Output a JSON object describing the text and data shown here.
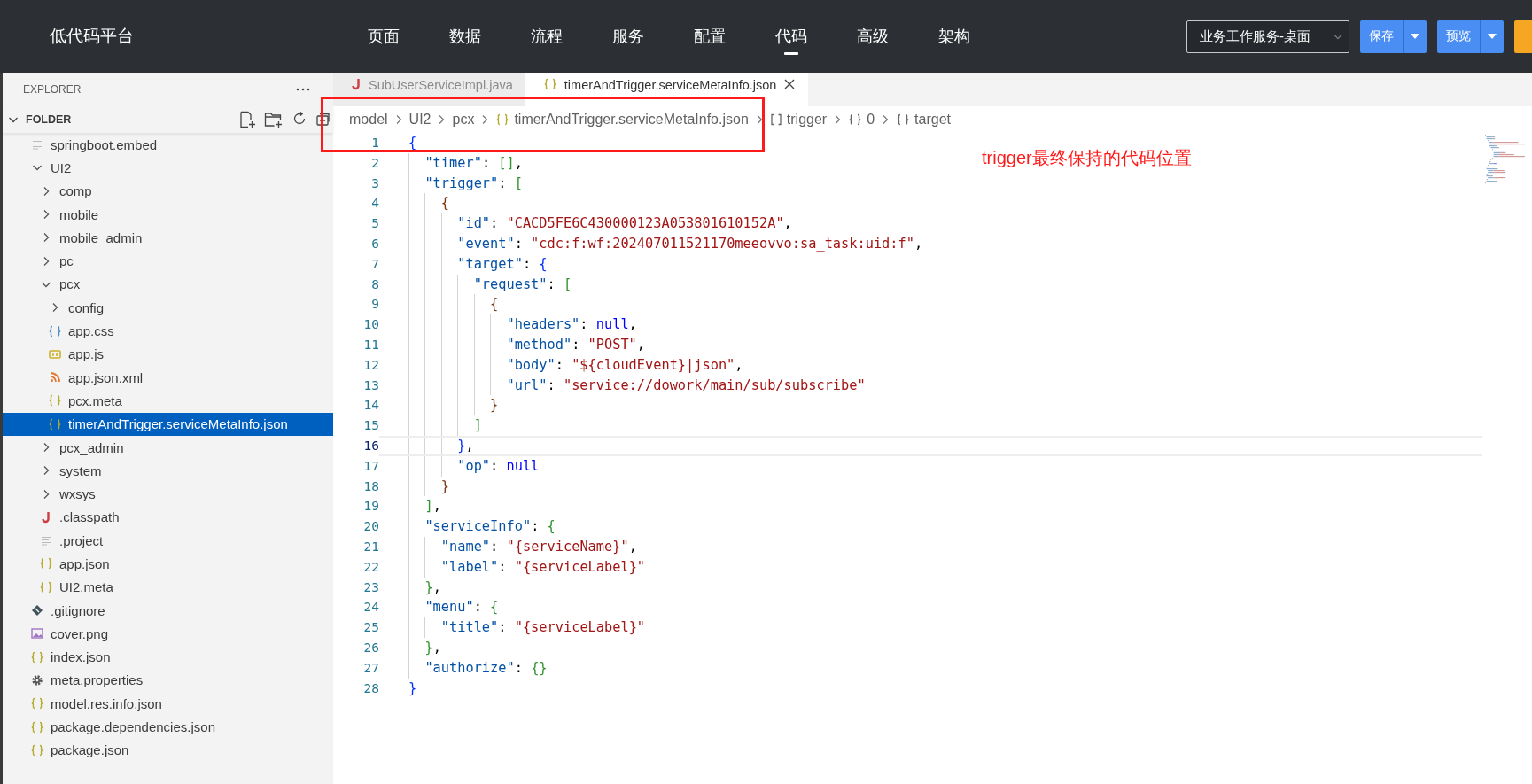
{
  "header": {
    "logo": "低代码平台",
    "nav": [
      {
        "label": "页面",
        "selected": false
      },
      {
        "label": "数据",
        "selected": false
      },
      {
        "label": "流程",
        "selected": false
      },
      {
        "label": "服务",
        "selected": false
      },
      {
        "label": "配置",
        "selected": false
      },
      {
        "label": "代码",
        "selected": true
      },
      {
        "label": "高级",
        "selected": false
      },
      {
        "label": "架构",
        "selected": false
      }
    ],
    "workspace_select": {
      "value": "业务工作服务-桌面"
    },
    "buttons": [
      {
        "kind": "split",
        "label": "保存"
      },
      {
        "kind": "split",
        "label": "预览"
      },
      {
        "kind": "partial"
      }
    ]
  },
  "explorer": {
    "title": "EXPLORER",
    "folder": {
      "label": "FOLDER",
      "expanded": true
    },
    "tree": [
      {
        "label": "springboot.embed",
        "kind": "text",
        "selected": false
      },
      {
        "label": "UI2",
        "kind": "folder",
        "expanded": true,
        "selected": false,
        "children": [
          {
            "label": "comp",
            "kind": "folder",
            "expanded": false,
            "selected": false
          },
          {
            "label": "mobile",
            "kind": "folder",
            "expanded": false,
            "selected": false
          },
          {
            "label": "mobile_admin",
            "kind": "folder",
            "expanded": false,
            "selected": false
          },
          {
            "label": "pc",
            "kind": "folder",
            "expanded": false,
            "selected": false
          },
          {
            "label": "pcx",
            "kind": "folder",
            "expanded": true,
            "selected": false,
            "children": [
              {
                "label": "config",
                "kind": "folder",
                "expanded": false,
                "selected": false
              },
              {
                "label": "app.css",
                "kind": "css",
                "selected": false
              },
              {
                "label": "app.js",
                "kind": "js",
                "selected": false
              },
              {
                "label": "app.json.xml",
                "kind": "feed",
                "selected": false
              },
              {
                "label": "pcx.meta",
                "kind": "json",
                "selected": false
              },
              {
                "label": "timerAndTrigger.serviceMetaInfo.json",
                "kind": "json",
                "selected": true
              }
            ]
          },
          {
            "label": "pcx_admin",
            "kind": "folder",
            "expanded": false,
            "selected": false
          },
          {
            "label": "system",
            "kind": "folder",
            "expanded": false,
            "selected": false
          },
          {
            "label": "wxsys",
            "kind": "folder",
            "expanded": false,
            "selected": false
          },
          {
            "label": ".classpath",
            "kind": "java",
            "selected": false
          },
          {
            "label": ".project",
            "kind": "text",
            "selected": false
          },
          {
            "label": "app.json",
            "kind": "json",
            "selected": false
          },
          {
            "label": "UI2.meta",
            "kind": "json",
            "selected": false
          }
        ]
      },
      {
        "label": ".gitignore",
        "kind": "git",
        "selected": false
      },
      {
        "label": "cover.png",
        "kind": "image",
        "selected": false
      },
      {
        "label": "index.json",
        "kind": "json",
        "selected": false
      },
      {
        "label": "meta.properties",
        "kind": "gear",
        "selected": false
      },
      {
        "label": "model.res.info.json",
        "kind": "json",
        "selected": false
      },
      {
        "label": "package.dependencies.json",
        "kind": "json",
        "selected": false
      },
      {
        "label": "package.json",
        "kind": "json",
        "selected": false
      }
    ]
  },
  "editor": {
    "tabs": [
      {
        "label": "SubUserServiceImpl.java",
        "kind": "java",
        "selected": false
      },
      {
        "label": "timerAndTrigger.serviceMetaInfo.json",
        "kind": "json",
        "selected": true
      }
    ],
    "breadcrumb": [
      {
        "label": "model"
      },
      {
        "label": "UI2"
      },
      {
        "label": "pcx"
      },
      {
        "label": "timerAndTrigger.serviceMetaInfo.json",
        "kind": "json"
      },
      {
        "label": "trigger",
        "kind": "array"
      },
      {
        "label": "0",
        "kind": "object"
      },
      {
        "label": "target",
        "kind": "object"
      }
    ],
    "lines": [
      {
        "number": "1",
        "current": false,
        "tokens": [
          {
            "kind": "ba",
            "text": "{"
          }
        ]
      },
      {
        "number": "2",
        "current": false,
        "tokens": [
          {
            "kind": "key",
            "text": "  \"timer\""
          },
          {
            "kind": "punct",
            "text": ": "
          },
          {
            "kind": "bb",
            "text": "[]"
          },
          {
            "kind": "punct",
            "text": ","
          }
        ]
      },
      {
        "number": "3",
        "current": false,
        "tokens": [
          {
            "kind": "key",
            "text": "  \"trigger\""
          },
          {
            "kind": "punct",
            "text": ": "
          },
          {
            "kind": "bb",
            "text": "["
          }
        ]
      },
      {
        "number": "4",
        "current": false,
        "tokens": [
          {
            "kind": "bc",
            "text": "    {"
          }
        ]
      },
      {
        "number": "5",
        "current": false,
        "tokens": [
          {
            "kind": "key",
            "text": "      \"id\""
          },
          {
            "kind": "punct",
            "text": ": "
          },
          {
            "kind": "str",
            "text": "\"CACD5FE6C430000123A053801610152A\""
          },
          {
            "kind": "punct",
            "text": ","
          }
        ]
      },
      {
        "number": "6",
        "current": false,
        "tokens": [
          {
            "kind": "key",
            "text": "      \"event\""
          },
          {
            "kind": "punct",
            "text": ": "
          },
          {
            "kind": "str",
            "text": "\"cdc:f:wf:202407011521170meeovvo:sa_task:uid:f\""
          },
          {
            "kind": "punct",
            "text": ","
          }
        ]
      },
      {
        "number": "7",
        "current": false,
        "tokens": [
          {
            "kind": "key",
            "text": "      \"target\""
          },
          {
            "kind": "punct",
            "text": ": "
          },
          {
            "kind": "ba",
            "text": "{"
          }
        ]
      },
      {
        "number": "8",
        "current": false,
        "tokens": [
          {
            "kind": "key",
            "text": "        \"request\""
          },
          {
            "kind": "punct",
            "text": ": "
          },
          {
            "kind": "bb",
            "text": "["
          }
        ]
      },
      {
        "number": "9",
        "current": false,
        "tokens": [
          {
            "kind": "bc",
            "text": "          {"
          }
        ]
      },
      {
        "number": "10",
        "current": false,
        "tokens": [
          {
            "kind": "key",
            "text": "            \"headers\""
          },
          {
            "kind": "punct",
            "text": ": "
          },
          {
            "kind": "null",
            "text": "null"
          },
          {
            "kind": "punct",
            "text": ","
          }
        ]
      },
      {
        "number": "11",
        "current": false,
        "tokens": [
          {
            "kind": "key",
            "text": "            \"method\""
          },
          {
            "kind": "punct",
            "text": ": "
          },
          {
            "kind": "str",
            "text": "\"POST\""
          },
          {
            "kind": "punct",
            "text": ","
          }
        ]
      },
      {
        "number": "12",
        "current": false,
        "tokens": [
          {
            "kind": "key",
            "text": "            \"body\""
          },
          {
            "kind": "punct",
            "text": ": "
          },
          {
            "kind": "str",
            "text": "\"${cloudEvent}|json\""
          },
          {
            "kind": "punct",
            "text": ","
          }
        ]
      },
      {
        "number": "13",
        "current": false,
        "tokens": [
          {
            "kind": "key",
            "text": "            \"url\""
          },
          {
            "kind": "punct",
            "text": ": "
          },
          {
            "kind": "str",
            "text": "\"service://dowork/main/sub/subscribe\""
          }
        ]
      },
      {
        "number": "14",
        "current": false,
        "tokens": [
          {
            "kind": "bc",
            "text": "          }"
          }
        ]
      },
      {
        "number": "15",
        "current": false,
        "tokens": [
          {
            "kind": "bb",
            "text": "        ]"
          }
        ]
      },
      {
        "number": "16",
        "current": true,
        "tokens": [
          {
            "kind": "ba",
            "text": "      }"
          },
          {
            "kind": "punct",
            "text": ","
          }
        ]
      },
      {
        "number": "17",
        "current": false,
        "tokens": [
          {
            "kind": "key",
            "text": "      \"op\""
          },
          {
            "kind": "punct",
            "text": ": "
          },
          {
            "kind": "null",
            "text": "null"
          }
        ]
      },
      {
        "number": "18",
        "current": false,
        "tokens": [
          {
            "kind": "bc",
            "text": "    }"
          }
        ]
      },
      {
        "number": "19",
        "current": false,
        "tokens": [
          {
            "kind": "bb",
            "text": "  ]"
          },
          {
            "kind": "punct",
            "text": ","
          }
        ]
      },
      {
        "number": "20",
        "current": false,
        "tokens": [
          {
            "kind": "key",
            "text": "  \"serviceInfo\""
          },
          {
            "kind": "punct",
            "text": ": "
          },
          {
            "kind": "bb",
            "text": "{"
          }
        ]
      },
      {
        "number": "21",
        "current": false,
        "tokens": [
          {
            "kind": "key",
            "text": "    \"name\""
          },
          {
            "kind": "punct",
            "text": ": "
          },
          {
            "kind": "str",
            "text": "\"{serviceName}\""
          },
          {
            "kind": "punct",
            "text": ","
          }
        ]
      },
      {
        "number": "22",
        "current": false,
        "tokens": [
          {
            "kind": "key",
            "text": "    \"label\""
          },
          {
            "kind": "punct",
            "text": ": "
          },
          {
            "kind": "str",
            "text": "\"{serviceLabel}\""
          }
        ]
      },
      {
        "number": "23",
        "current": false,
        "tokens": [
          {
            "kind": "bb",
            "text": "  }"
          },
          {
            "kind": "punct",
            "text": ","
          }
        ]
      },
      {
        "number": "24",
        "current": false,
        "tokens": [
          {
            "kind": "key",
            "text": "  \"menu\""
          },
          {
            "kind": "punct",
            "text": ": "
          },
          {
            "kind": "bb",
            "text": "{"
          }
        ]
      },
      {
        "number": "25",
        "current": false,
        "tokens": [
          {
            "kind": "key",
            "text": "    \"title\""
          },
          {
            "kind": "punct",
            "text": ": "
          },
          {
            "kind": "str",
            "text": "\"{serviceLabel}\""
          }
        ]
      },
      {
        "number": "26",
        "current": false,
        "tokens": [
          {
            "kind": "bb",
            "text": "  }"
          },
          {
            "kind": "punct",
            "text": ","
          }
        ]
      },
      {
        "number": "27",
        "current": false,
        "tokens": [
          {
            "kind": "key",
            "text": "  \"authorize\""
          },
          {
            "kind": "punct",
            "text": ": "
          },
          {
            "kind": "bb",
            "text": "{}"
          }
        ]
      },
      {
        "number": "28",
        "current": false,
        "tokens": [
          {
            "kind": "ba",
            "text": "}"
          }
        ]
      }
    ]
  },
  "annotation": {
    "text": "trigger最终保持的代码位置",
    "box": true
  }
}
